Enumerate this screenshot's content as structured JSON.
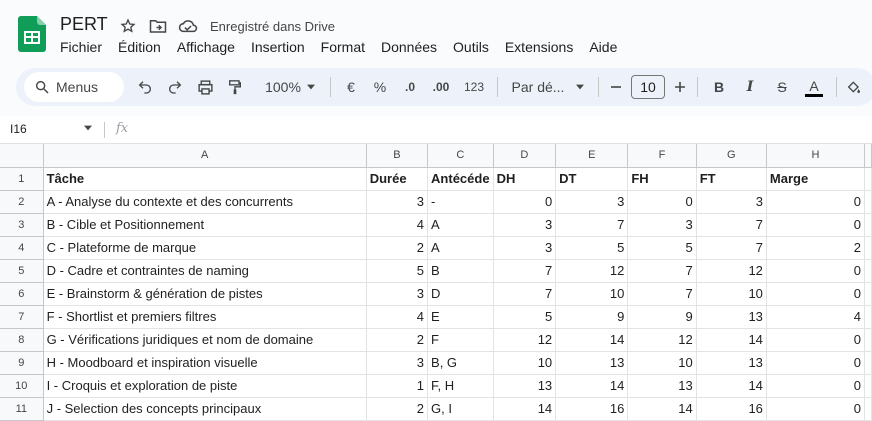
{
  "app": {
    "title": "PERT",
    "saved_status": "Enregistré dans Drive"
  },
  "menu": [
    "Fichier",
    "Édition",
    "Affichage",
    "Insertion",
    "Format",
    "Données",
    "Outils",
    "Extensions",
    "Aide"
  ],
  "toolbar": {
    "search_label": "Menus",
    "zoom": "100%",
    "currency": "€",
    "percent": "%",
    "dec_decrease": ".0",
    "dec_increase": ".00",
    "number_format": "123",
    "font": "Par dé...",
    "font_size": "10",
    "bold": "B",
    "italic": "I",
    "strike": "S",
    "text_color": "A"
  },
  "formula_bar": {
    "name_box": "I16",
    "fx": "fx"
  },
  "grid": {
    "columns": [
      "A",
      "B",
      "C",
      "D",
      "E",
      "F",
      "G",
      "H"
    ],
    "header_row": [
      "Tâche",
      "Durée",
      "Antécéde",
      "DH",
      "DT",
      "FH",
      "FT",
      "Marge"
    ],
    "rows": [
      [
        "A - Analyse du contexte et des concurrents",
        "3",
        "-",
        "0",
        "3",
        "0",
        "3",
        "0"
      ],
      [
        "B - Cible et Positionnement",
        "4",
        "A",
        "3",
        "7",
        "3",
        "7",
        "0"
      ],
      [
        "C - Plateforme de marque",
        "2",
        "A",
        "3",
        "5",
        "5",
        "7",
        "2"
      ],
      [
        "D - Cadre et contraintes de naming",
        "5",
        "B",
        "7",
        "12",
        "7",
        "12",
        "0"
      ],
      [
        "E - Brainstorm & génération de pistes",
        "3",
        "D",
        "7",
        "10",
        "7",
        "10",
        "0"
      ],
      [
        "F - Shortlist et premiers filtres",
        "4",
        "E",
        "5",
        "9",
        "9",
        "13",
        "4"
      ],
      [
        "G - Vérifications juridiques et nom de domaine",
        "2",
        "F",
        "12",
        "14",
        "12",
        "14",
        "0"
      ],
      [
        "H - Moodboard et inspiration visuelle",
        "3",
        "B, G",
        "10",
        "13",
        "10",
        "13",
        "0"
      ],
      [
        "I - Croquis et exploration de piste",
        "1",
        "F, H",
        "13",
        "14",
        "13",
        "14",
        "0"
      ],
      [
        "J - Selection des concepts principaux",
        "2",
        "G, I",
        "14",
        "16",
        "14",
        "16",
        "0"
      ]
    ]
  },
  "colors": {
    "sheets_green": "#0f9d58",
    "toolbar_bg": "#edf2fa",
    "header_bg": "#f8f9fa"
  }
}
